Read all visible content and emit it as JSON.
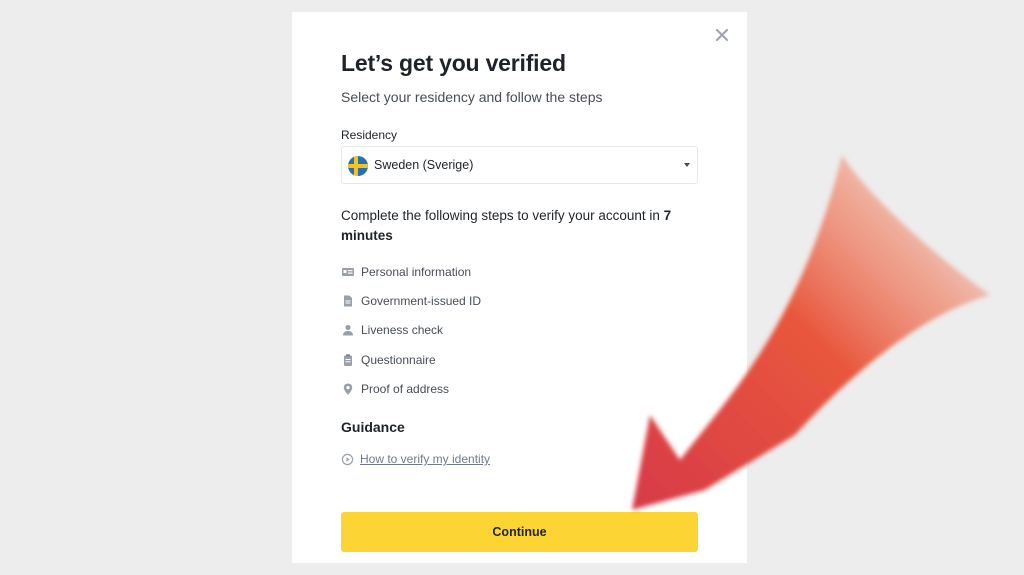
{
  "modal": {
    "title": "Let’s get you verified",
    "subtitle": "Select your residency and follow the steps",
    "residency_label": "Residency",
    "residency_value": "Sweden (Sverige)",
    "steps_intro_prefix": "Complete the following steps to verify your account in ",
    "steps_intro_time": "7 minutes",
    "steps": [
      {
        "label": "Personal information",
        "icon": "id-card-icon"
      },
      {
        "label": "Government-issued ID",
        "icon": "document-icon"
      },
      {
        "label": "Liveness check",
        "icon": "person-icon"
      },
      {
        "label": "Questionnaire",
        "icon": "clipboard-icon"
      },
      {
        "label": "Proof of address",
        "icon": "location-pin-icon"
      }
    ],
    "guidance_title": "Guidance",
    "guidance_link": "How to verify my identity",
    "continue_label": "Continue"
  },
  "colors": {
    "page_background": "#ededed",
    "primary_button": "#fcd535",
    "text_primary": "#1e2329",
    "text_secondary": "#474d57",
    "annotation_arrow": "#e2473c"
  }
}
